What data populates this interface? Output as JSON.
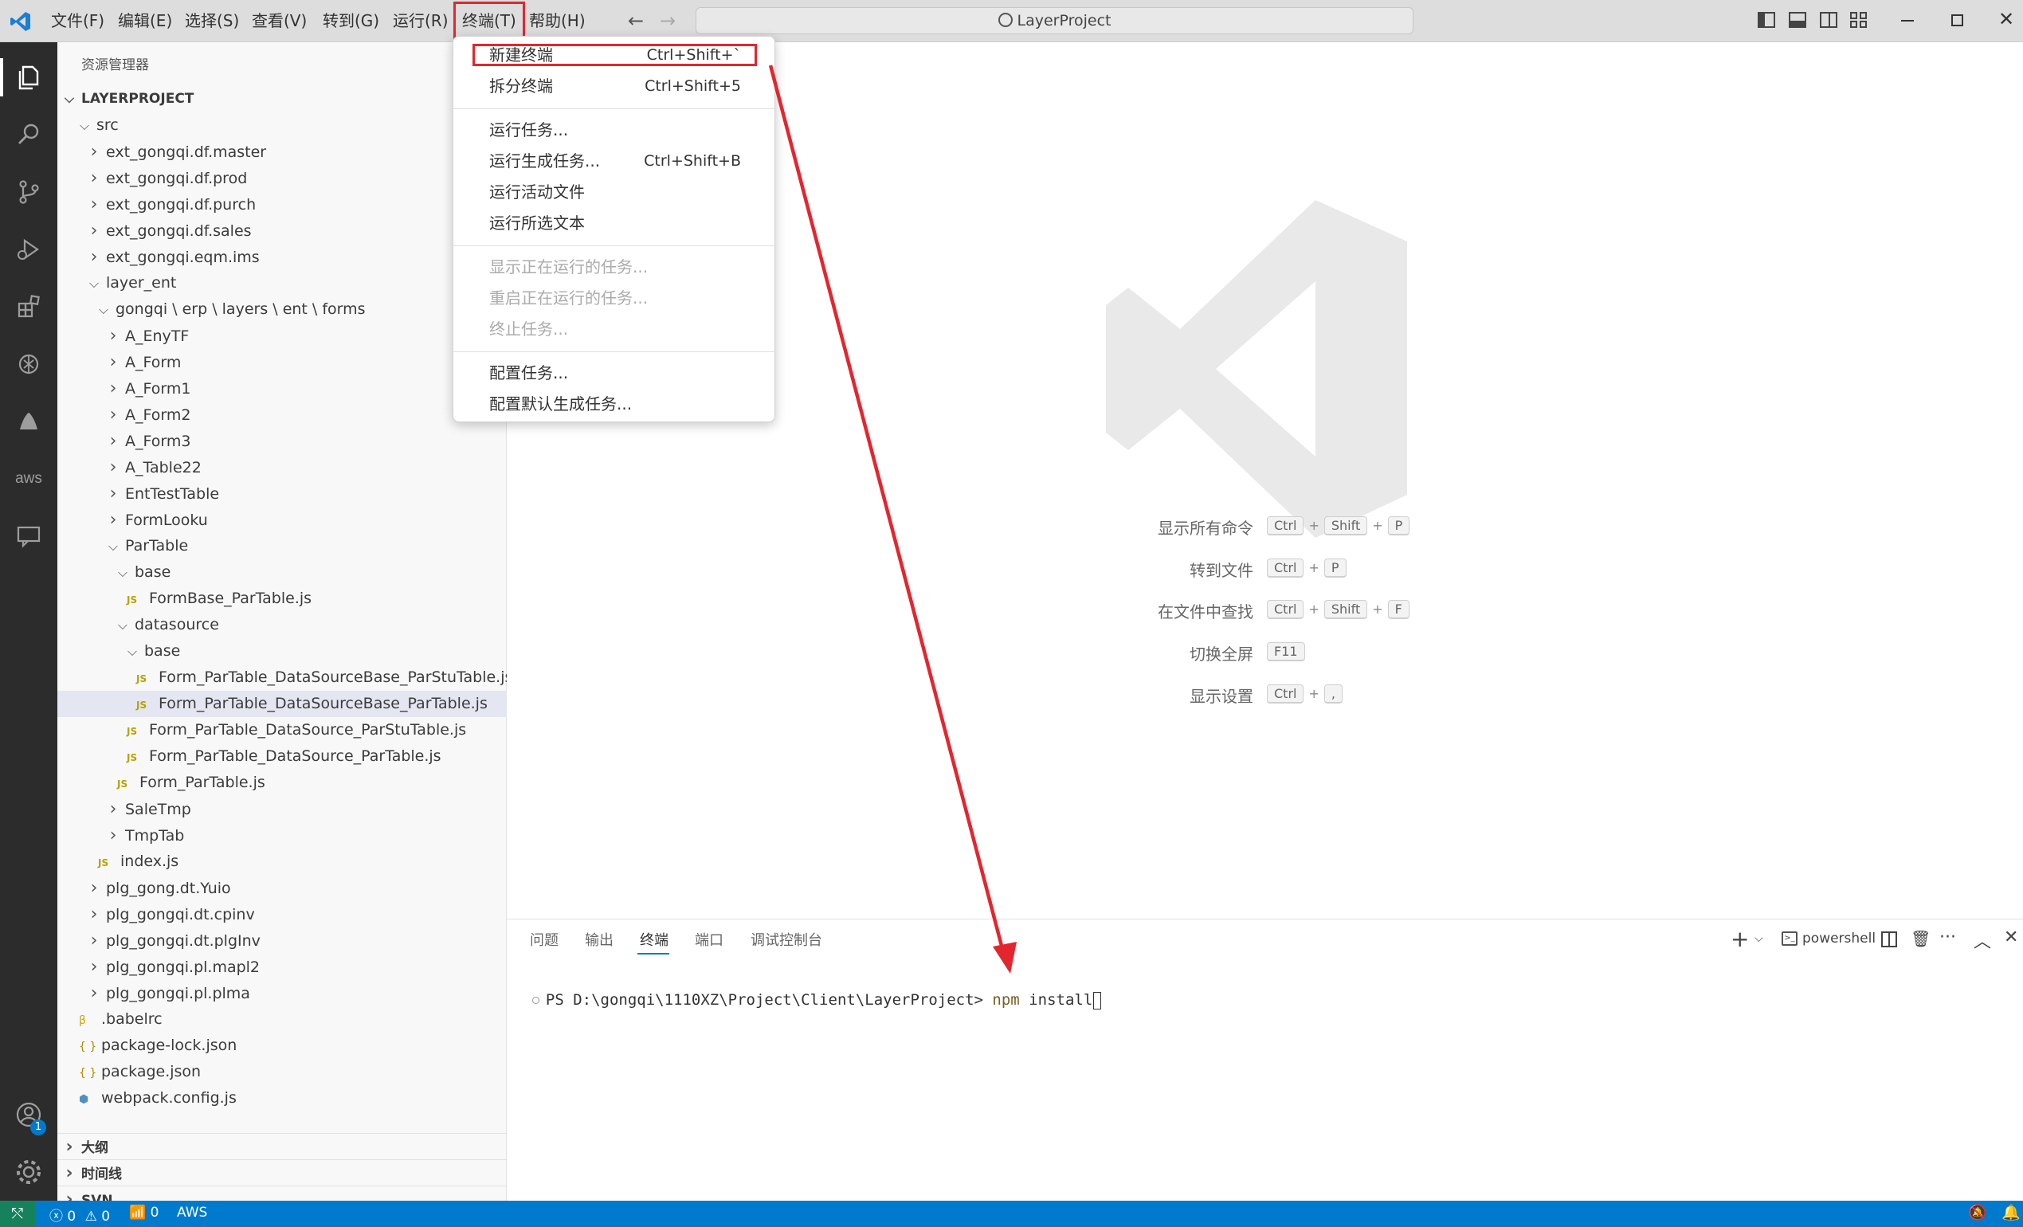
{
  "titlebar": {
    "menus": [
      "文件(F)",
      "编辑(E)",
      "选择(S)",
      "查看(V)",
      "转到(G)",
      "运行(R)",
      "终端(T)",
      "帮助(H)"
    ],
    "search": "LayerProject"
  },
  "sidebar": {
    "title": "资源管理器",
    "project": "LAYERPROJECT",
    "tree": [
      {
        "label": "src",
        "kind": "folder-open",
        "indent": 0
      },
      {
        "label": "ext_gongqi.df.master",
        "kind": "folder",
        "indent": 1
      },
      {
        "label": "ext_gongqi.df.prod",
        "kind": "folder",
        "indent": 1
      },
      {
        "label": "ext_gongqi.df.purch",
        "kind": "folder",
        "indent": 1
      },
      {
        "label": "ext_gongqi.df.sales",
        "kind": "folder",
        "indent": 1
      },
      {
        "label": "ext_gongqi.eqm.ims",
        "kind": "folder",
        "indent": 1
      },
      {
        "label": "layer_ent",
        "kind": "folder-open",
        "indent": 1
      },
      {
        "label": "gongqi \\ erp \\ layers \\ ent \\ forms",
        "kind": "folder-open",
        "indent": 2
      },
      {
        "label": "A_EnyTF",
        "kind": "folder",
        "indent": 3
      },
      {
        "label": "A_Form",
        "kind": "folder",
        "indent": 3
      },
      {
        "label": "A_Form1",
        "kind": "folder",
        "indent": 3
      },
      {
        "label": "A_Form2",
        "kind": "folder",
        "indent": 3
      },
      {
        "label": "A_Form3",
        "kind": "folder",
        "indent": 3
      },
      {
        "label": "A_Table22",
        "kind": "folder",
        "indent": 3
      },
      {
        "label": "EntTestTable",
        "kind": "folder",
        "indent": 3
      },
      {
        "label": "FormLooku",
        "kind": "folder",
        "indent": 3
      },
      {
        "label": "ParTable",
        "kind": "folder-open",
        "indent": 3
      },
      {
        "label": "base",
        "kind": "folder-open",
        "indent": 4
      },
      {
        "label": "FormBase_ParTable.js",
        "kind": "js",
        "indent": 5
      },
      {
        "label": "datasource",
        "kind": "folder-open",
        "indent": 4
      },
      {
        "label": "base",
        "kind": "folder-open",
        "indent": 5
      },
      {
        "label": "Form_ParTable_DataSourceBase_ParStuTable.js",
        "kind": "js",
        "indent": 6
      },
      {
        "label": "Form_ParTable_DataSourceBase_ParTable.js",
        "kind": "js",
        "indent": 6,
        "selected": true
      },
      {
        "label": "Form_ParTable_DataSource_ParStuTable.js",
        "kind": "js",
        "indent": 5
      },
      {
        "label": "Form_ParTable_DataSource_ParTable.js",
        "kind": "js",
        "indent": 5
      },
      {
        "label": "Form_ParTable.js",
        "kind": "js",
        "indent": 4
      },
      {
        "label": "SaleTmp",
        "kind": "folder",
        "indent": 3
      },
      {
        "label": "TmpTab",
        "kind": "folder",
        "indent": 3
      },
      {
        "label": "index.js",
        "kind": "js",
        "indent": 2
      },
      {
        "label": "plg_gong.dt.Yuio",
        "kind": "folder",
        "indent": 1
      },
      {
        "label": "plg_gongqi.dt.cpinv",
        "kind": "folder",
        "indent": 1
      },
      {
        "label": "plg_gongqi.dt.plgInv",
        "kind": "folder",
        "indent": 1
      },
      {
        "label": "plg_gongqi.pl.mapl2",
        "kind": "folder",
        "indent": 1
      },
      {
        "label": "plg_gongqi.pl.plma",
        "kind": "folder",
        "indent": 1
      },
      {
        "label": ".babelrc",
        "kind": "babel",
        "indent": 0
      },
      {
        "label": "package-lock.json",
        "kind": "json",
        "indent": 0
      },
      {
        "label": "package.json",
        "kind": "json",
        "indent": 0
      },
      {
        "label": "webpack.config.js",
        "kind": "webpack",
        "indent": 0
      }
    ],
    "sections": [
      "大纲",
      "时间线",
      "SVN"
    ]
  },
  "dropdown": {
    "groups": [
      [
        {
          "label": "新建终端",
          "shortcut": "Ctrl+Shift+`",
          "highlight": true
        },
        {
          "label": "拆分终端",
          "shortcut": "Ctrl+Shift+5"
        }
      ],
      [
        {
          "label": "运行任务...",
          "shortcut": ""
        },
        {
          "label": "运行生成任务...",
          "shortcut": "Ctrl+Shift+B"
        },
        {
          "label": "运行活动文件",
          "shortcut": ""
        },
        {
          "label": "运行所选文本",
          "shortcut": ""
        }
      ],
      [
        {
          "label": "显示正在运行的任务...",
          "shortcut": "",
          "disabled": true
        },
        {
          "label": "重启正在运行的任务...",
          "shortcut": "",
          "disabled": true
        },
        {
          "label": "终止任务...",
          "shortcut": "",
          "disabled": true
        }
      ],
      [
        {
          "label": "配置任务...",
          "shortcut": ""
        },
        {
          "label": "配置默认生成任务...",
          "shortcut": ""
        }
      ]
    ]
  },
  "editor": {
    "shortcuts": [
      {
        "label": "显示所有命令",
        "keys": [
          "Ctrl",
          "Shift",
          "P"
        ]
      },
      {
        "label": "转到文件",
        "keys": [
          "Ctrl",
          "P"
        ]
      },
      {
        "label": "在文件中查找",
        "keys": [
          "Ctrl",
          "Shift",
          "F"
        ]
      },
      {
        "label": "切换全屏",
        "keys": [
          "F11"
        ]
      },
      {
        "label": "显示设置",
        "keys": [
          "Ctrl",
          ","
        ]
      }
    ]
  },
  "panel": {
    "tabs": [
      "问题",
      "输出",
      "终端",
      "端口",
      "调试控制台"
    ],
    "active_tab": "终端",
    "shell": "powershell",
    "prompt": "PS D:\\gongqi\\1110XZ\\Project\\Client\\LayerProject>",
    "command": "npm",
    "args": "install"
  },
  "statusbar": {
    "errors": "0",
    "warnings": "0",
    "ports": "0",
    "aws": "AWS"
  },
  "accounts_badge": "1",
  "colors": {
    "accent": "#007acc",
    "annotation": "#e3262e"
  }
}
